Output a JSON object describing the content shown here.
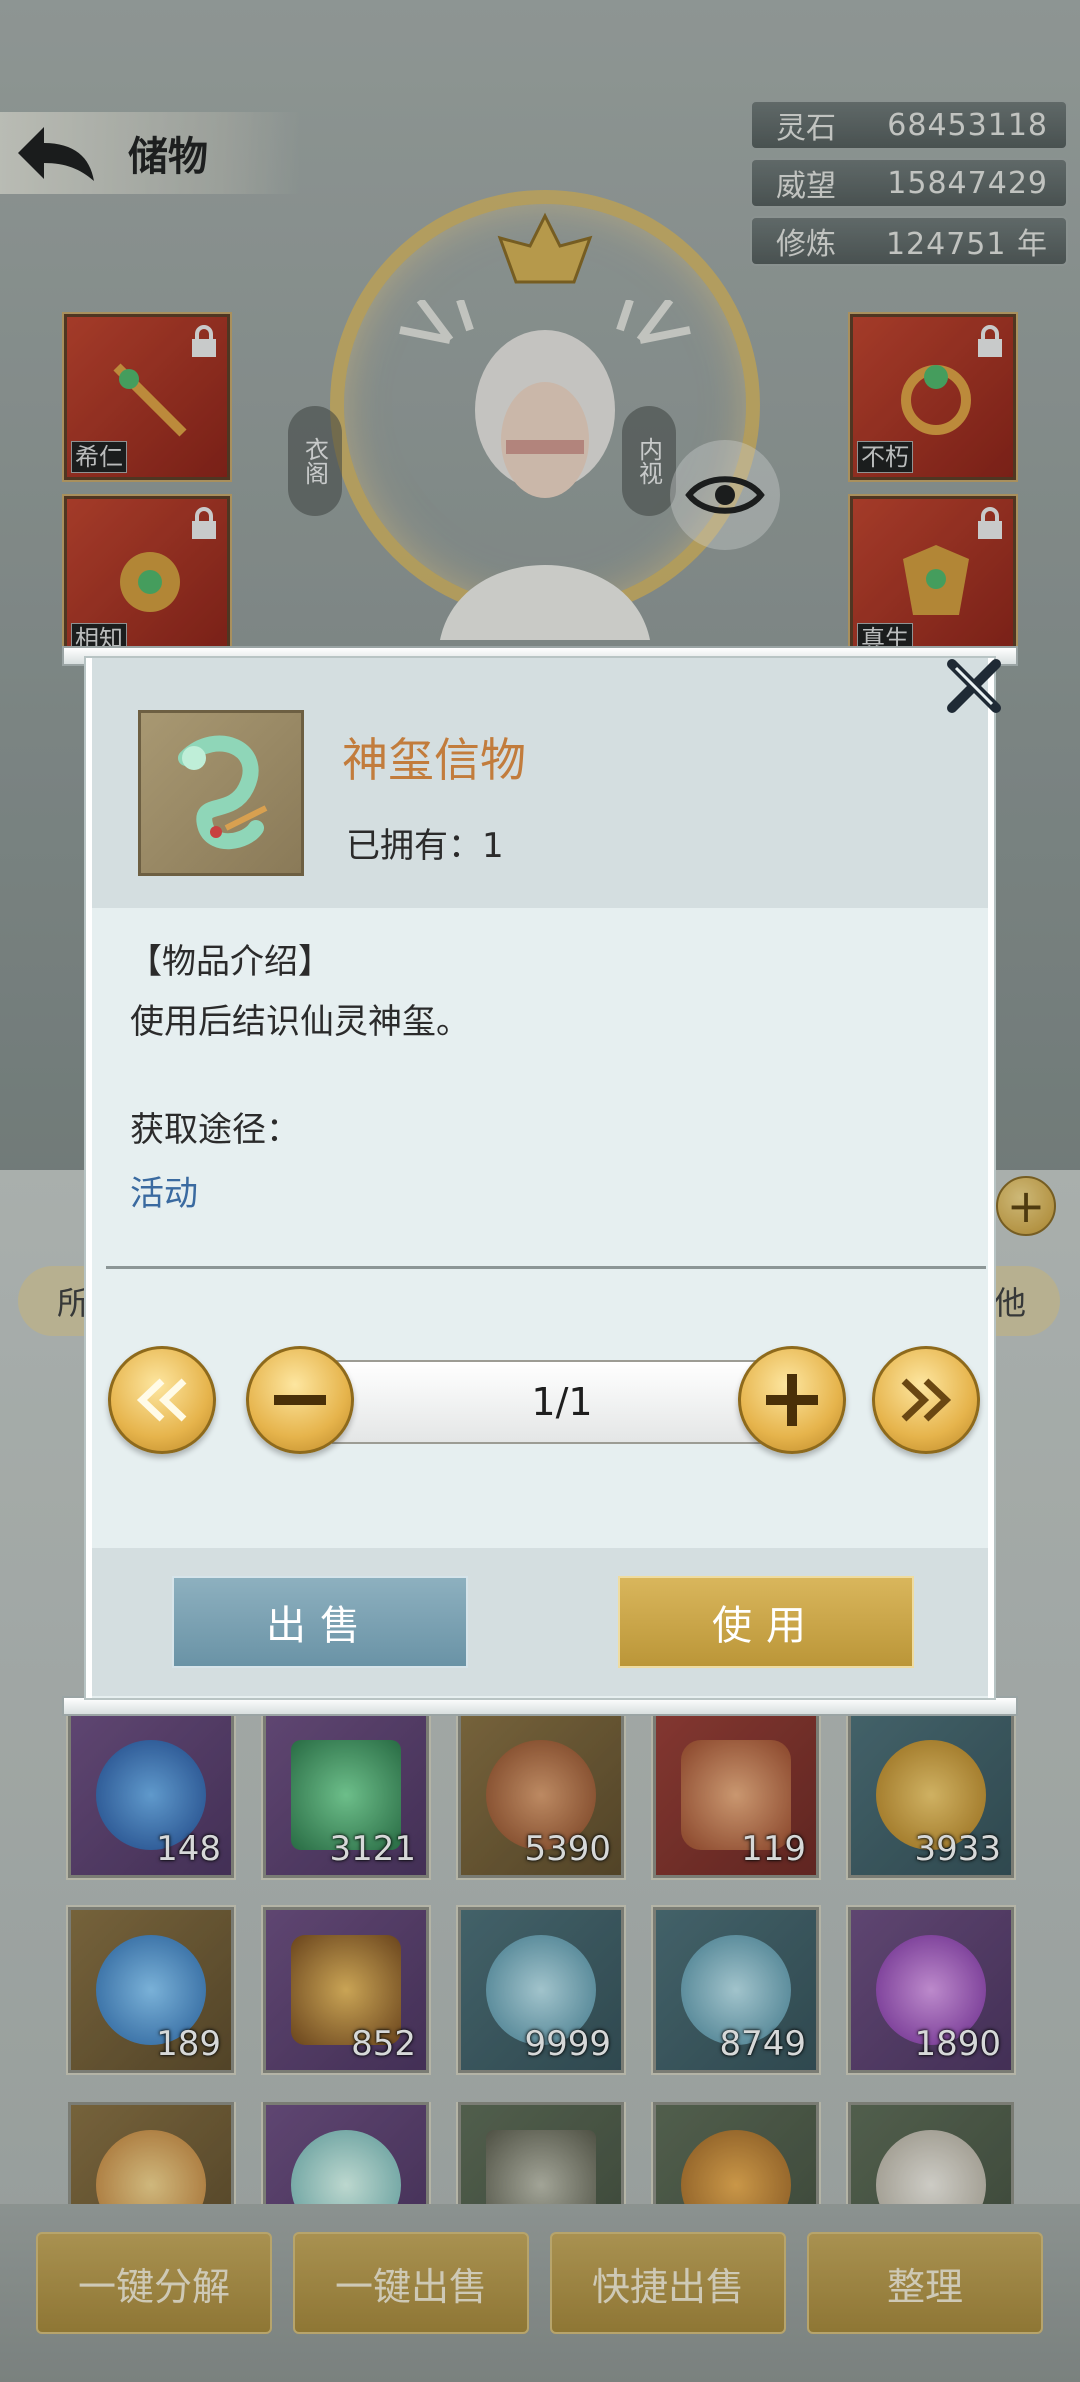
{
  "header": {
    "title": "储物"
  },
  "stats": [
    {
      "label": "灵石",
      "value": "68453118"
    },
    {
      "label": "威望",
      "value": "15847429"
    },
    {
      "label": "修炼",
      "value": "124751 年"
    }
  ],
  "character": {
    "left_button": "衣阁",
    "right_button": "内视"
  },
  "equipment": {
    "left": [
      {
        "seal": "希仁",
        "color": "#c2402a"
      },
      {
        "seal": "相知"
      }
    ],
    "right": [
      {
        "seal": "不朽"
      },
      {
        "seal": "真生"
      }
    ]
  },
  "inventory": {
    "tabs": {
      "left": "所",
      "right": "他"
    },
    "rows": [
      [
        {
          "count": "148",
          "tone": "purple"
        },
        {
          "count": "3121",
          "tone": "purple"
        },
        {
          "count": "5390",
          "tone": "amber"
        },
        {
          "count": "119",
          "tone": "red"
        },
        {
          "count": "3933",
          "tone": "teal"
        }
      ],
      [
        {
          "count": "189",
          "tone": "amber"
        },
        {
          "count": "852",
          "tone": "purple"
        },
        {
          "count": "9999",
          "tone": "teal"
        },
        {
          "count": "8749",
          "tone": "teal"
        },
        {
          "count": "1890",
          "tone": "purple"
        }
      ],
      [
        {
          "count": "",
          "tone": "amber"
        },
        {
          "count": "",
          "tone": "purple"
        },
        {
          "count": "",
          "tone": "green"
        },
        {
          "count": "",
          "tone": "green"
        },
        {
          "count": "",
          "tone": "green"
        }
      ]
    ]
  },
  "bottom_actions": [
    "一键分解",
    "一键出售",
    "快捷出售",
    "整理"
  ],
  "dialog": {
    "item_name": "神玺信物",
    "owned": "已拥有：1",
    "desc_header": "【物品介绍】",
    "desc_text": "使用后结识仙灵神玺。",
    "source_label": "获取途径：",
    "source_value": "活动",
    "quantity": "1/1",
    "sell_label": "出售",
    "use_label": "使用"
  },
  "icons": {
    "back": "back-arrow-icon",
    "close": "close-x-icon",
    "eye": "eye-icon",
    "lock": "lock-icon",
    "min": "double-chevron-left-icon",
    "minus": "minus-icon",
    "plus": "plus-icon",
    "max": "double-chevron-right-icon"
  }
}
